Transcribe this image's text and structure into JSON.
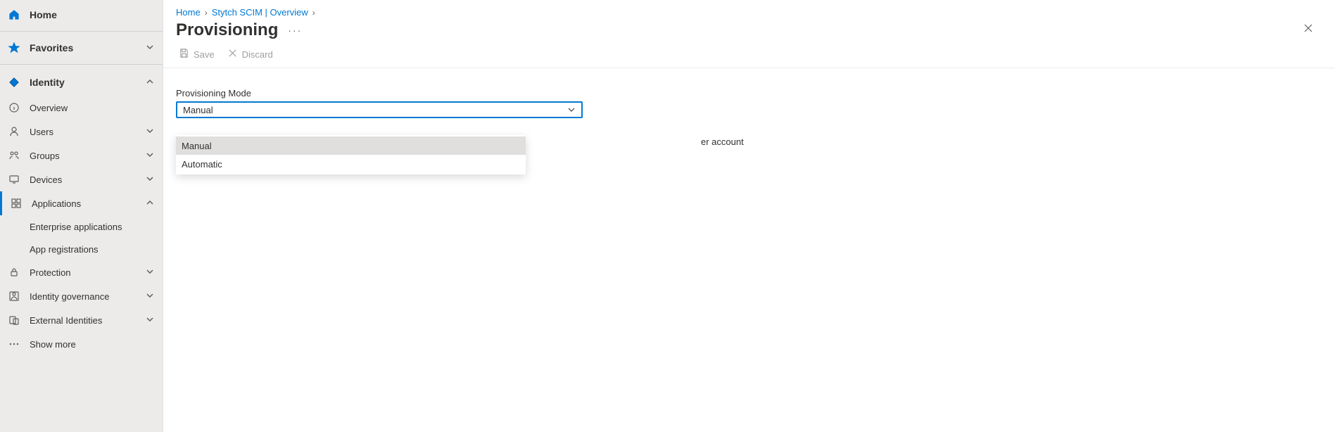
{
  "sidebar": {
    "home": "Home",
    "favorites": "Favorites",
    "identity": "Identity",
    "overview": "Overview",
    "users": "Users",
    "groups": "Groups",
    "devices": "Devices",
    "applications": "Applications",
    "applications_children": {
      "enterprise_applications": "Enterprise applications",
      "app_registrations": "App registrations"
    },
    "protection": "Protection",
    "identity_governance": "Identity governance",
    "external_identities": "External Identities",
    "show_more": "Show more"
  },
  "breadcrumb": {
    "home": "Home",
    "app": "Stytch SCIM | Overview"
  },
  "page": {
    "title": "Provisioning",
    "more": "···"
  },
  "toolbar": {
    "save": "Save",
    "discard": "Discard"
  },
  "form": {
    "label": "Provisioning Mode",
    "selected": "Manual",
    "options": {
      "manual": "Manual",
      "automatic": "Automatic"
    },
    "description_fragment": "er account"
  }
}
